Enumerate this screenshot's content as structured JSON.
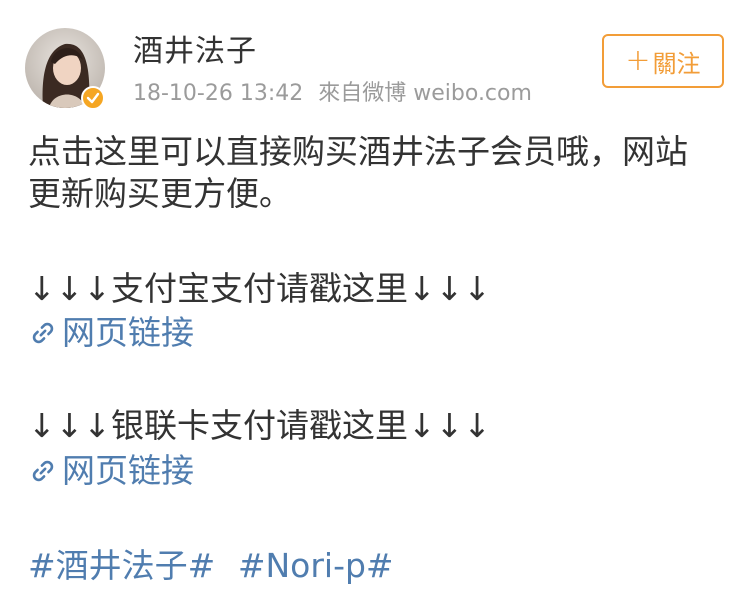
{
  "user": {
    "name": "酒井法子",
    "timestamp": "18-10-26 13:42",
    "source": "來自微博 weibo.com",
    "verified": true
  },
  "follow_button": {
    "plus": "+",
    "label": "關注",
    "color": "#f29d38"
  },
  "post": {
    "line1": "点击这里可以直接购买酒井法子会员哦，网站",
    "line2": "更新购买更方便。",
    "alipay_heading": "↓↓↓支付宝支付请戳这里↓↓↓",
    "alipay_link": "网页链接",
    "unionpay_heading": "↓↓↓银联卡支付请戳这里↓↓↓",
    "unionpay_link": "网页链接"
  },
  "topics": [
    "#酒井法子#",
    "#Nori-p#"
  ],
  "colors": {
    "link": "#507daf",
    "text": "#333333",
    "meta": "#9b9b9b",
    "badge": "#f5a623"
  },
  "icons": {
    "avatar": "user-photo",
    "badge": "verified-check-icon",
    "link": "link-icon"
  }
}
